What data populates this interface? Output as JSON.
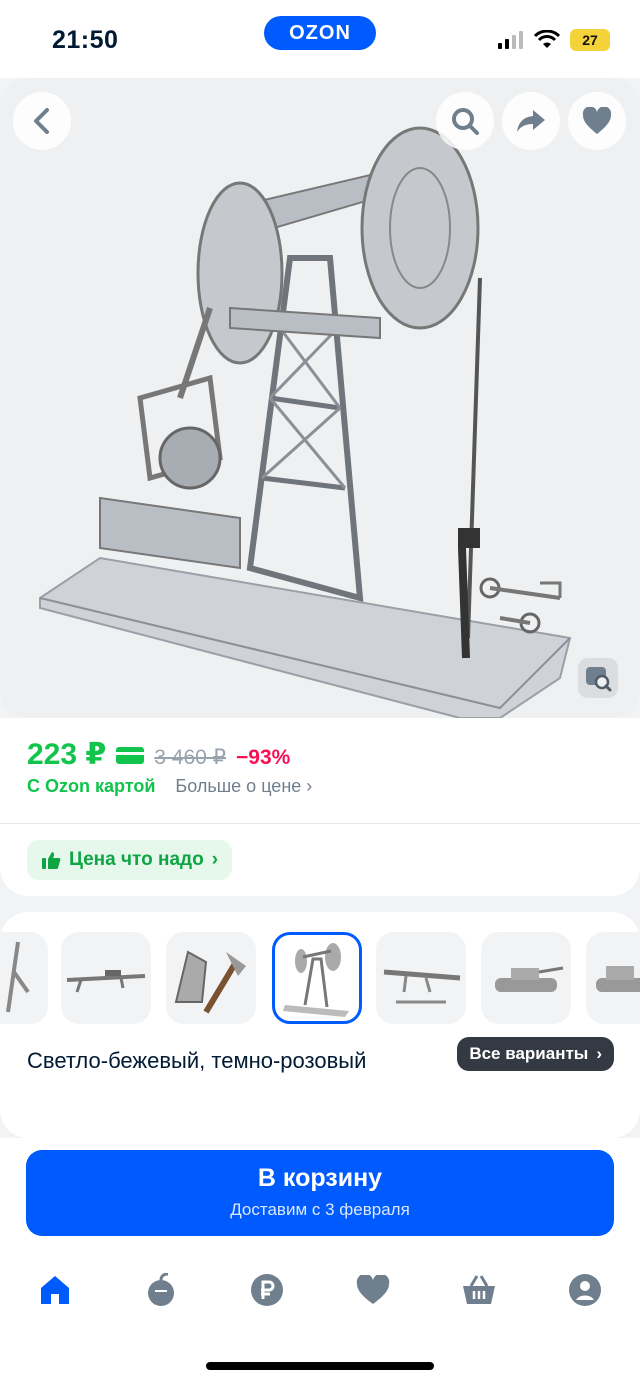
{
  "status": {
    "time": "21:50",
    "battery": "27"
  },
  "brand": {
    "logo": "OZON"
  },
  "hero": {
    "back_icon": "chevron-left-icon",
    "search_icon": "search-icon",
    "share_icon": "share-icon",
    "favorite_icon": "heart-icon",
    "zoom_icon": "image-search-icon"
  },
  "price": {
    "current": "223 ₽",
    "old": "3 460 ₽",
    "discount": "−93%",
    "card_label": "С Ozon картой",
    "more_label": "Больше о цене"
  },
  "tag": {
    "label": "Цена что надо"
  },
  "variants": {
    "color_name": "Светло-бежевый, темно-розовый",
    "all_label": "Все варианты",
    "thumbs": [
      "crane",
      "sniper-rifle",
      "axes",
      "oil-pump",
      "rifle",
      "tank",
      "tank-2"
    ]
  },
  "cart": {
    "title": "В корзину",
    "subtitle": "Доставим с 3 февраля"
  },
  "tabs": [
    "home-icon",
    "fresh-icon",
    "ruble-icon",
    "heart-icon",
    "cart-icon",
    "profile-icon"
  ],
  "colors": {
    "accent": "#005bff",
    "green": "#10c44c",
    "pink": "#f91155"
  }
}
